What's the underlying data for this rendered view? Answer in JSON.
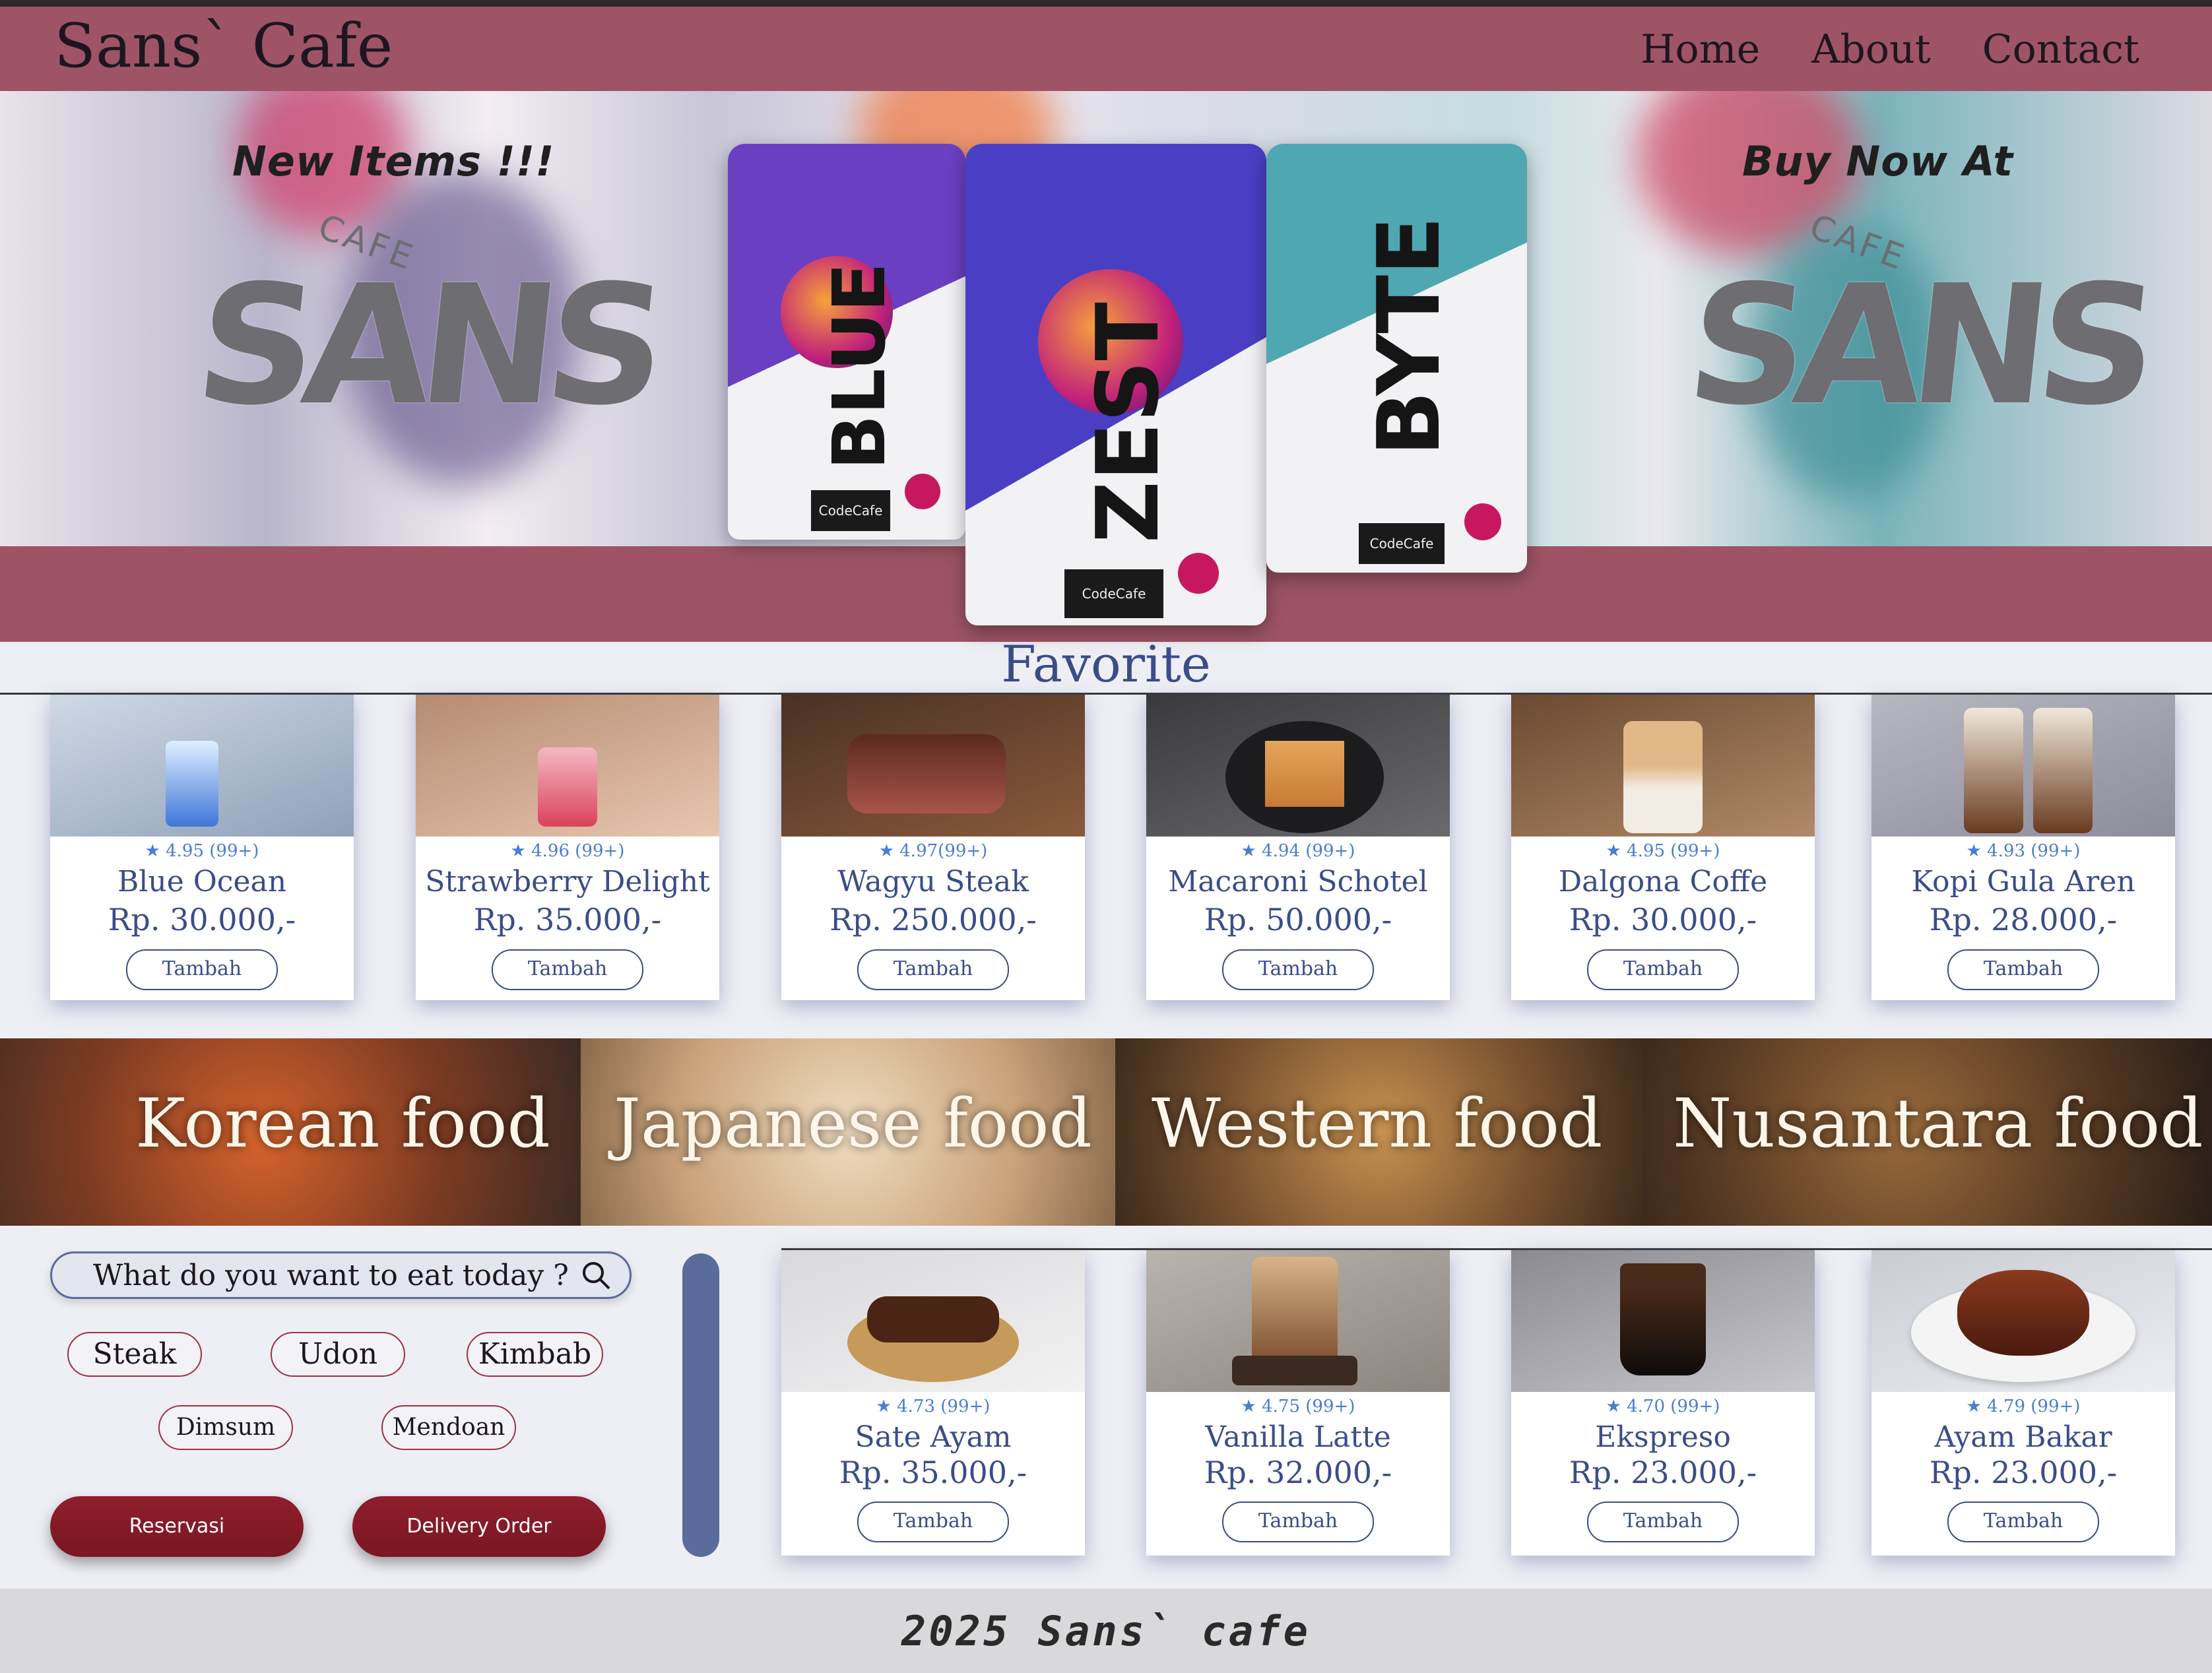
{
  "header": {
    "brand": "Sans` Cafe",
    "nav": [
      "Home",
      "About",
      "Contact"
    ]
  },
  "hero": {
    "left_text": "New Items !!!",
    "right_text": "Buy Now At",
    "logo_word": "SANS",
    "logo_small": "CAFE",
    "bags": [
      {
        "word": "BLUE",
        "label": "CodeCafe",
        "color": "#6a3fc2"
      },
      {
        "word": "ZEST",
        "label": "CodeCafe",
        "color": "#4a3fc4"
      },
      {
        "word": "BYTE",
        "label": "CodeCafe",
        "color": "#4fa7b2"
      }
    ]
  },
  "favorite": {
    "title": "Favorite",
    "items": [
      {
        "rating": "★ 4.95 (99+)",
        "name": "Blue Ocean",
        "price": "Rp. 30.000,-",
        "button": "Tambah"
      },
      {
        "rating": "★ 4.96 (99+)",
        "name": "Strawberry Delight",
        "price": "Rp. 35.000,-",
        "button": "Tambah"
      },
      {
        "rating": "★ 4.97(99+)",
        "name": "Wagyu Steak",
        "price": "Rp. 250.000,-",
        "button": "Tambah"
      },
      {
        "rating": "★ 4.94 (99+)",
        "name": "Macaroni Schotel",
        "price": "Rp. 50.000,-",
        "button": "Tambah"
      },
      {
        "rating": "★ 4.95 (99+)",
        "name": "Dalgona Coffe",
        "price": "Rp. 30.000,-",
        "button": "Tambah"
      },
      {
        "rating": "★ 4.93 (99+)",
        "name": "Kopi Gula Aren",
        "price": "Rp. 28.000,-",
        "button": "Tambah"
      }
    ]
  },
  "categories": [
    "Korean food",
    "Japanese food",
    "Western food",
    "Nusantara food"
  ],
  "search": {
    "placeholder": "What do you want to eat today ?"
  },
  "chips": [
    "Steak",
    "Udon",
    "Kimbab",
    "Dimsum",
    "Mendoan"
  ],
  "actions": {
    "reservasi": "Reservasi",
    "delivery": "Delivery Order"
  },
  "menu": {
    "items": [
      {
        "rating": "★ 4.73 (99+)",
        "name": "Sate Ayam",
        "price": "Rp. 35.000,-",
        "button": "Tambah"
      },
      {
        "rating": "★ 4.75 (99+)",
        "name": "Vanilla Latte",
        "price": "Rp. 32.000,-",
        "button": "Tambah"
      },
      {
        "rating": "★ 4.70 (99+)",
        "name": "Ekspreso",
        "price": "Rp. 23.000,-",
        "button": "Tambah"
      },
      {
        "rating": "★ 4.79 (99+)",
        "name": "Ayam Bakar",
        "price": "Rp. 23.000,-",
        "button": "Tambah"
      }
    ]
  },
  "footer": {
    "text": "2025 Sans` cafe"
  }
}
